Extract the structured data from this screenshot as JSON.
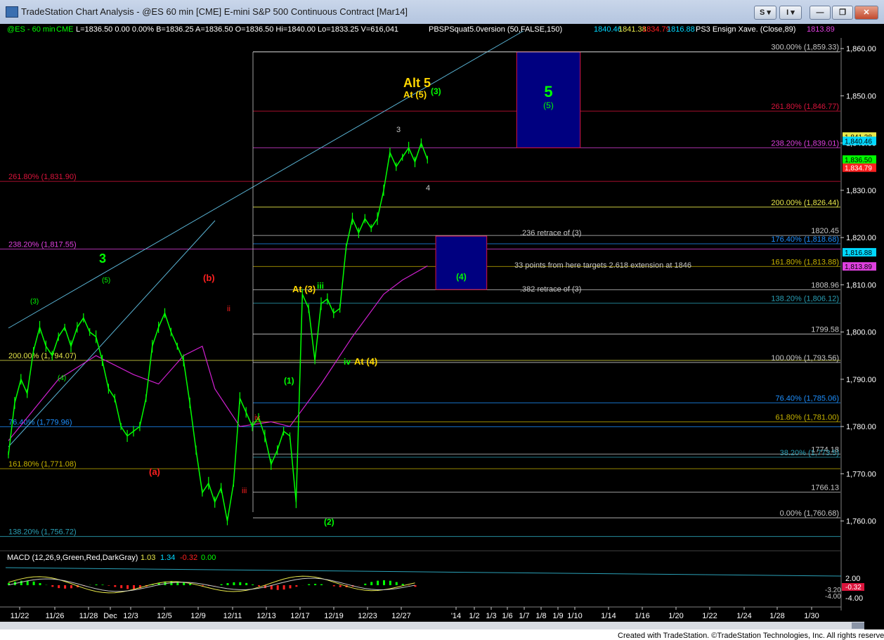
{
  "window": {
    "title": "TradeStation Chart Analysis - @ES 60 min [CME] E-mini S&P 500 Continuous Contract [Mar14]",
    "buttons": [
      "S",
      "I"
    ]
  },
  "header": {
    "symbol": "@ES - 60 min",
    "exchange": "CME",
    "quote": "L=1836.50  0.00  0.00%  B=1836.25  A=1836.50  O=1836.50  Hi=1840.00  Lo=1833.25  V=616,041",
    "indicator1": "PBSPSquat5.0version (50,FALSE,150)",
    "indicator1_values": [
      "1840.46",
      "1841.38",
      "1834.79",
      "1816.88"
    ],
    "indicator2": "PS3 Ensign Xave. (Close,89)",
    "indicator2_value": "1813.89"
  },
  "chart_data": {
    "type": "line",
    "title": "",
    "xlabel": "",
    "ylabel": "",
    "ylim": [
      1753,
      1865
    ],
    "y_ticks": [
      1760,
      1770,
      1780,
      1790,
      1800,
      1810,
      1820,
      1830,
      1840,
      1850,
      1860
    ],
    "y_tick_labels": [
      "1,760.00",
      "1,770.00",
      "1,780.00",
      "1,790.00",
      "1,800.00",
      "1,810.00",
      "1,820.00",
      "1,830.00",
      "1,840.00",
      "1,850.00",
      "1,860.00"
    ],
    "x_tick_labels": [
      "11/22",
      "11/26",
      "11/28",
      "Dec",
      "12/3",
      "12/5",
      "12/9",
      "12/11",
      "12/13",
      "12/17",
      "12/19",
      "12/23",
      "12/27",
      "'14",
      "1/2",
      "1/3",
      "1/6",
      "1/7",
      "1/8",
      "1/9",
      "1/10",
      "1/14",
      "1/16",
      "1/20",
      "1/22",
      "1/24",
      "1/28",
      "1/30"
    ],
    "price_series": {
      "name": "@ES 60 min",
      "color": "#00ff00",
      "points": [
        [
          0,
          1774
        ],
        [
          1,
          1785
        ],
        [
          2,
          1790
        ],
        [
          3,
          1787
        ],
        [
          4,
          1796
        ],
        [
          5,
          1801
        ],
        [
          6,
          1797
        ],
        [
          7,
          1795
        ],
        [
          8,
          1799
        ],
        [
          9,
          1801
        ],
        [
          10,
          1797
        ],
        [
          11,
          1801
        ],
        [
          12,
          1803
        ],
        [
          13,
          1800
        ],
        [
          14,
          1799
        ],
        [
          15,
          1794
        ],
        [
          16,
          1788
        ],
        [
          17,
          1786
        ],
        [
          18,
          1780
        ],
        [
          19,
          1778
        ],
        [
          20,
          1779
        ],
        [
          21,
          1780
        ],
        [
          22,
          1786
        ],
        [
          23,
          1797
        ],
        [
          24,
          1801
        ],
        [
          25,
          1804
        ],
        [
          26,
          1800
        ],
        [
          27,
          1797
        ],
        [
          28,
          1794
        ],
        [
          29,
          1785
        ],
        [
          30,
          1775
        ],
        [
          31,
          1766
        ],
        [
          32,
          1768
        ],
        [
          33,
          1764
        ],
        [
          34,
          1767
        ],
        [
          35,
          1760
        ],
        [
          36,
          1768
        ],
        [
          37,
          1786
        ],
        [
          38,
          1783
        ],
        [
          39,
          1780
        ],
        [
          40,
          1782
        ],
        [
          41,
          1778
        ],
        [
          42,
          1772
        ],
        [
          43,
          1775
        ],
        [
          44,
          1779
        ],
        [
          45,
          1778
        ],
        [
          46,
          1764
        ],
        [
          47,
          1808
        ],
        [
          48,
          1805
        ],
        [
          49,
          1794
        ],
        [
          50,
          1806
        ],
        [
          51,
          1807
        ],
        [
          52,
          1804
        ],
        [
          53,
          1805
        ],
        [
          54,
          1818
        ],
        [
          55,
          1824
        ],
        [
          56,
          1821
        ],
        [
          57,
          1824
        ],
        [
          58,
          1822
        ],
        [
          59,
          1824
        ],
        [
          60,
          1830
        ],
        [
          61,
          1838
        ],
        [
          62,
          1835
        ],
        [
          63,
          1837
        ],
        [
          64,
          1839
        ],
        [
          65,
          1836
        ],
        [
          66,
          1840
        ],
        [
          67,
          1836.5
        ]
      ]
    },
    "ma_series": {
      "name": "PS3 Ensign Xave. (Close,89)",
      "color": "#d020d0",
      "points": [
        [
          0,
          1777
        ],
        [
          8,
          1790
        ],
        [
          14,
          1795
        ],
        [
          20,
          1791
        ],
        [
          24,
          1789
        ],
        [
          28,
          1795
        ],
        [
          31,
          1797
        ],
        [
          33,
          1788
        ],
        [
          37,
          1780
        ],
        [
          42,
          1781
        ],
        [
          45,
          1780
        ],
        [
          50,
          1789
        ],
        [
          55,
          1799
        ],
        [
          60,
          1808
        ],
        [
          63,
          1811
        ],
        [
          67,
          1814
        ]
      ]
    },
    "horizontal_levels": [
      {
        "value": 1859.33,
        "label": "300.00% (1,859.33)",
        "color": "#c7c7c7",
        "side": "right"
      },
      {
        "value": 1846.77,
        "label": "261.80% (1,846.77)",
        "color": "#dc143c",
        "side": "right"
      },
      {
        "value": 1839.01,
        "label": "238.20% (1,839.01)",
        "color": "#e040e0",
        "side": "right"
      },
      {
        "value": 1831.9,
        "label": "261.80% (1,831.90)",
        "color": "#dc143c",
        "side": "left"
      },
      {
        "value": 1826.44,
        "label": "200.00% (1,826.44)",
        "color": "#e8e84a",
        "side": "right"
      },
      {
        "value": 1820.45,
        "label": "1820.45",
        "color": "#c7c7c7",
        "side": "right"
      },
      {
        "value": 1818.68,
        "label": "176.40% (1,818.68)",
        "color": "#1e90ff",
        "side": "right"
      },
      {
        "value": 1817.55,
        "label": "238.20% (1,817.55)",
        "color": "#e040e0",
        "side": "left"
      },
      {
        "value": 1813.88,
        "label": "161.80% (1,813.88)",
        "color": "#c8b400",
        "side": "right"
      },
      {
        "value": 1808.96,
        "label": "1808.96",
        "color": "#c7c7c7",
        "side": "right"
      },
      {
        "value": 1806.12,
        "label": "138.20% (1,806.12)",
        "color": "#2a9fb5",
        "side": "right"
      },
      {
        "value": 1799.58,
        "label": "1799.58",
        "color": "#c7c7c7",
        "side": "right"
      },
      {
        "value": 1794.0,
        "label": "200.00% (1,794.07)",
        "color": "#e8e84a",
        "side": "left"
      },
      {
        "value": 1793.56,
        "label": "100.00% (1,793.56)",
        "color": "#c7c7c7",
        "side": "right"
      },
      {
        "value": 1785.0,
        "label": "76.40% (1,785.06)",
        "color": "#1e90ff",
        "side": "right"
      },
      {
        "value": 1781.0,
        "label": "61.80% (1,781.00)",
        "color": "#c8b400",
        "side": "right"
      },
      {
        "value": 1779.96,
        "label": "76.40% (1,779.96)",
        "color": "#1e90ff",
        "side": "left"
      },
      {
        "value": 1774.18,
        "label": "1774.18",
        "color": "#c7c7c7",
        "side": "right"
      },
      {
        "value": 1773.5,
        "label": "38.20% (1,773.5)",
        "color": "#2a9fb5",
        "side": "right"
      },
      {
        "value": 1771.08,
        "label": "161.80% (1,771.08)",
        "color": "#c8b400",
        "side": "left"
      },
      {
        "value": 1766.13,
        "label": "1766.13",
        "color": "#c7c7c7",
        "side": "right"
      },
      {
        "value": 1760.68,
        "label": "0.00% (1,760.68)",
        "color": "#c7c7c7",
        "side": "right"
      },
      {
        "value": 1756.72,
        "label": "138.20% (1,756.72)",
        "color": "#2a9fb5",
        "side": "left"
      }
    ],
    "target_boxes": [
      {
        "from_x": 57,
        "to_x": 63,
        "from": 1839.0,
        "to": 1859.3,
        "label": "5",
        "sublabel": "(5)"
      },
      {
        "from_x": 49,
        "to_x": 53,
        "from": 1809.0,
        "to": 1820.3,
        "label": "(4)"
      },
      {
        "from_x": 28,
        "to_x": 34,
        "from": 1753.0,
        "to": 1761.0,
        "label": ""
      }
    ],
    "annotations": [
      {
        "text": "3",
        "color": "#00ff00",
        "size": "large"
      },
      {
        "text": "(5)",
        "color": "#00ff00"
      },
      {
        "text": "(3)",
        "color": "#00ff00"
      },
      {
        "text": "(4)",
        "color": "#00ff00"
      },
      {
        "text": "(b)",
        "color": "#ff2020"
      },
      {
        "text": "(a)",
        "color": "#ff2020"
      },
      {
        "text": "ii",
        "color": "#ff2020"
      },
      {
        "text": "iii",
        "color": "#ff2020"
      },
      {
        "text": "iv",
        "color": "#ff2020"
      },
      {
        "text": "(1)",
        "color": "#00ff00"
      },
      {
        "text": "(2)",
        "color": "#00ff00"
      },
      {
        "text": "At (3)",
        "color": "#ffd700"
      },
      {
        "text": "iii",
        "color": "#00ff00"
      },
      {
        "text": "iv",
        "color": "#00ff00"
      },
      {
        "text": "At (4)",
        "color": "#ffd700"
      },
      {
        "text": "Alt 5",
        "color": "#ffd700",
        "size": "large"
      },
      {
        "text": "At (5)",
        "color": "#ffd700"
      },
      {
        "text": "(3)",
        "color": "#00ff00"
      },
      {
        "text": "3",
        "color": "#c7c7c7"
      },
      {
        "text": "4",
        "color": "#c7c7c7"
      },
      {
        "text": ".236 retrace of (3)",
        "color": "#c7c7c7"
      },
      {
        "text": "33 points from here targets 2.618 extension at 1846",
        "color": "#c7c7c7"
      },
      {
        "text": ".382 retrace of (3)",
        "color": "#c7c7c7"
      }
    ],
    "right_axis_labels": [
      {
        "text": "1,841.38",
        "value": 1841.38,
        "color": "#e8e84a"
      },
      {
        "text": "1,840.46",
        "value": 1840.46,
        "color": "#00d8ff"
      },
      {
        "text": "1,836.50",
        "value": 1836.5,
        "color": "#00ff00"
      },
      {
        "text": "1,834.79",
        "value": 1834.79,
        "color": "#ff2020"
      },
      {
        "text": "1,816.88",
        "value": 1816.88,
        "color": "#00d8ff"
      },
      {
        "text": "1,813.89",
        "value": 1813.89,
        "color": "#e040e0"
      }
    ],
    "macd": {
      "title": "MACD (12,26,9,Green,Red,DarkGray)",
      "values": [
        "1.03",
        "1.34",
        "-0.32",
        "0.00"
      ],
      "ylim": [
        -5,
        3
      ],
      "y_ticks": [
        2.0,
        -4.0
      ],
      "y_tick_labels": [
        "2.00",
        "-4.00"
      ],
      "extra_labels": [
        "-3.20",
        "-0.32",
        "-4.00"
      ]
    }
  },
  "footer": "Created with TradeStation. ©TradeStation Technologies, Inc. All rights reserved."
}
